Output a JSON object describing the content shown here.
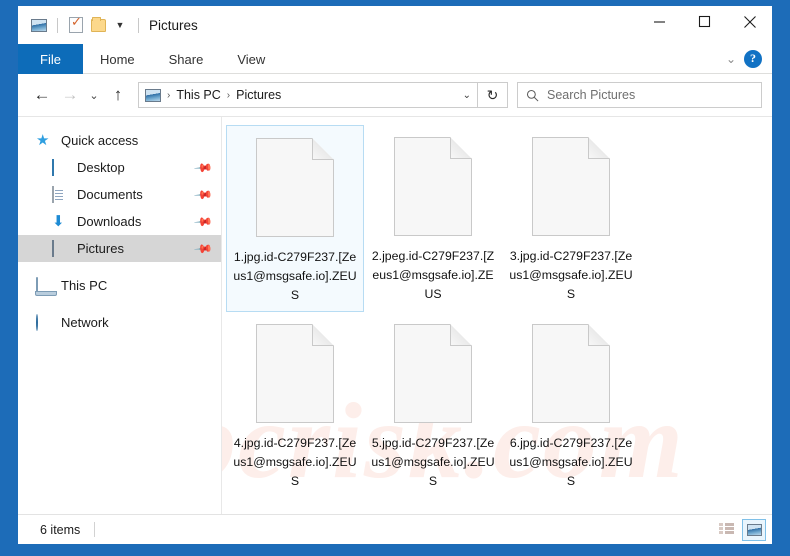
{
  "window": {
    "title": "Pictures",
    "quick_access": [
      {
        "name": "pictures-icon",
        "label": "Pictures"
      },
      {
        "name": "properties-icon",
        "label": "Properties"
      },
      {
        "name": "new-folder-icon",
        "label": "New folder"
      },
      {
        "name": "customize-caret-icon",
        "label": "▾"
      }
    ],
    "controls": {
      "minimize": "Minimize",
      "maximize": "Maximize",
      "close": "Close"
    }
  },
  "ribbon": {
    "tabs": [
      {
        "label": "File",
        "active": true
      },
      {
        "label": "Home",
        "active": false
      },
      {
        "label": "Share",
        "active": false
      },
      {
        "label": "View",
        "active": false
      }
    ],
    "expand_caret": "⌄",
    "help_label": "?"
  },
  "address": {
    "back": "←",
    "forward": "→",
    "recent": "⌄",
    "up": "↑",
    "breadcrumbs": [
      "This PC",
      "Pictures"
    ],
    "separator": "›",
    "dropdown_caret": "⌄",
    "refresh": "↻"
  },
  "search": {
    "placeholder": "Search Pictures",
    "icon": "search-icon"
  },
  "sidebar": {
    "items": [
      {
        "label": "Quick access",
        "icon": "star-icon",
        "level": "root",
        "pinned": false,
        "selected": false
      },
      {
        "label": "Desktop",
        "icon": "desktop-icon",
        "level": "child",
        "pinned": true,
        "selected": false
      },
      {
        "label": "Documents",
        "icon": "documents-icon",
        "level": "child",
        "pinned": true,
        "selected": false
      },
      {
        "label": "Downloads",
        "icon": "downloads-icon",
        "level": "child",
        "pinned": true,
        "selected": false
      },
      {
        "label": "Pictures",
        "icon": "pictures-icon",
        "level": "child",
        "pinned": true,
        "selected": true
      },
      {
        "label": "This PC",
        "icon": "this-pc-icon",
        "level": "root",
        "pinned": false,
        "selected": false
      },
      {
        "label": "Network",
        "icon": "network-icon",
        "level": "root",
        "pinned": false,
        "selected": false
      }
    ],
    "pin_glyph": "📌"
  },
  "files": [
    {
      "name": "1.jpg.id-C279F237.[Zeus1@msgsafe.io].ZEUS",
      "icon": "blank-file-icon",
      "selected": true
    },
    {
      "name": "2.jpeg.id-C279F237.[Zeus1@msgsafe.io].ZEUS",
      "icon": "blank-file-icon",
      "selected": false
    },
    {
      "name": "3.jpg.id-C279F237.[Zeus1@msgsafe.io].ZEUS",
      "icon": "blank-file-icon",
      "selected": false
    },
    {
      "name": "4.jpg.id-C279F237.[Zeus1@msgsafe.io].ZEUS",
      "icon": "blank-file-icon",
      "selected": false
    },
    {
      "name": "5.jpg.id-C279F237.[Zeus1@msgsafe.io].ZEUS",
      "icon": "blank-file-icon",
      "selected": false
    },
    {
      "name": "6.jpg.id-C279F237.[Zeus1@msgsafe.io].ZEUS",
      "icon": "blank-file-icon",
      "selected": false
    }
  ],
  "watermark": {
    "text": "pcrisk.com"
  },
  "statusbar": {
    "item_count": "6 items",
    "views": [
      {
        "name": "details-view-button",
        "active": false
      },
      {
        "name": "large-icons-view-button",
        "active": true
      }
    ]
  },
  "colors": {
    "frame_blue": "#1d6cb8",
    "file_tab_blue": "#0d6cb9",
    "selection_blue": "#f4fafe",
    "selection_border": "#b7dcf3",
    "sidebar_selected": "#d6d6d6"
  }
}
